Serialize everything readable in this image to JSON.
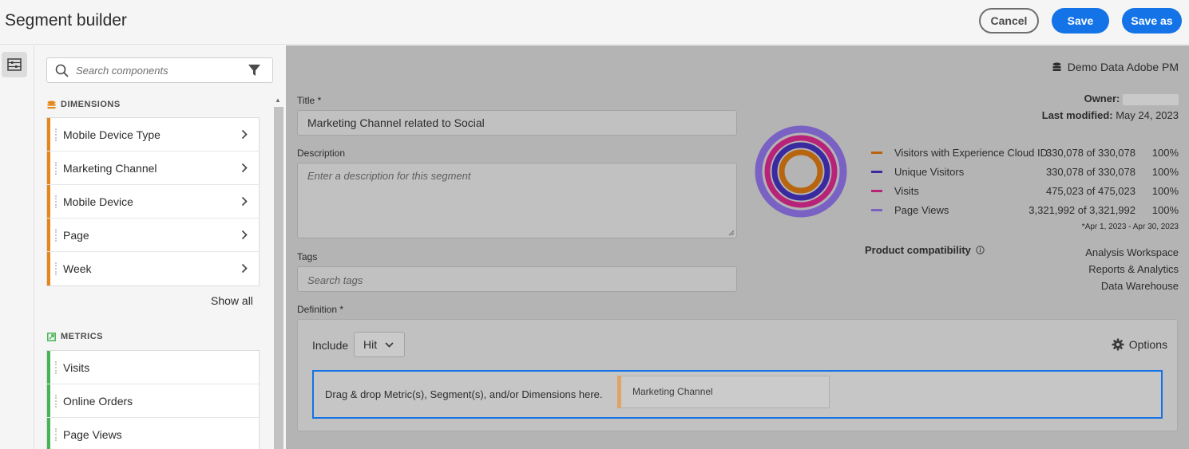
{
  "header": {
    "title": "Segment builder",
    "cancel_label": "Cancel",
    "save_label": "Save",
    "saveas_label": "Save as"
  },
  "left_panel": {
    "search_placeholder": "Search components",
    "dimensions": {
      "title": "DIMENSIONS",
      "accent_color": "#e68619",
      "items": [
        {
          "label": "Mobile Device Type"
        },
        {
          "label": "Marketing Channel"
        },
        {
          "label": "Mobile Device"
        },
        {
          "label": "Page"
        },
        {
          "label": "Week"
        }
      ],
      "show_all": "Show all"
    },
    "metrics": {
      "title": "METRICS",
      "accent_color": "#44b556",
      "items": [
        {
          "label": "Visits"
        },
        {
          "label": "Online Orders"
        },
        {
          "label": "Page Views"
        }
      ]
    }
  },
  "form": {
    "title_label": "Title",
    "required_mark": "*",
    "title_value": "Marketing Channel related to Social",
    "description_label": "Description",
    "description_placeholder": "Enter a description for this segment",
    "tags_label": "Tags",
    "tags_placeholder": "Search tags",
    "definition_label": "Definition"
  },
  "info": {
    "data_source": "Demo Data Adobe PM",
    "owner_label": "Owner:",
    "last_modified_label": "Last modified:",
    "last_modified_value": "May 24, 2023",
    "legend": [
      {
        "name": "Visitors with Experience Cloud ID",
        "value": "330,078 of 330,078",
        "percent": "100%",
        "color": "#b8650f"
      },
      {
        "name": "Unique Visitors",
        "value": "330,078 of 330,078",
        "percent": "100%",
        "color": "#3a2aa0"
      },
      {
        "name": "Visits",
        "value": "475,023 of 475,023",
        "percent": "100%",
        "color": "#b8237a"
      },
      {
        "name": "Page Views",
        "value": "3,321,992 of 3,321,992",
        "percent": "100%",
        "color": "#7a62c4"
      }
    ],
    "date_range": "*Apr 1, 2023 - Apr 30, 2023",
    "product_compat_label": "Product compatibility",
    "product_compat": [
      "Analysis Workspace",
      "Reports & Analytics",
      "Data Warehouse"
    ]
  },
  "definition": {
    "include_label": "Include",
    "scope_value": "Hit",
    "options_label": "Options",
    "dropzone_text": "Drag & drop Metric(s), Segment(s), and/or Dimensions here.",
    "chip_label": "Marketing Channel"
  }
}
